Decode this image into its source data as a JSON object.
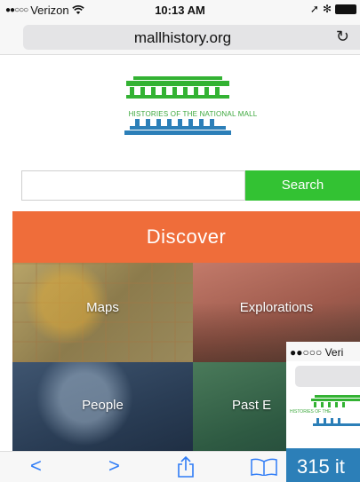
{
  "status_bar": {
    "signal": "●●○○○",
    "carrier": "Verizon",
    "wifi_icon": "wifi-icon",
    "time": "10:13 AM",
    "location_icon": "➚",
    "bluetooth_icon": "✻"
  },
  "url_bar": {
    "url": "mallhistory.org",
    "reload_glyph": "↻"
  },
  "site": {
    "logo_text": "HISTORIES OF THE NATIONAL MALL",
    "colors": {
      "green": "#33c233",
      "blue": "#2c7fb8",
      "orange": "#ef6d3a"
    }
  },
  "search": {
    "placeholder": "",
    "button_label": "Search"
  },
  "discover": {
    "heading": "Discover",
    "tiles": [
      {
        "label": "Maps"
      },
      {
        "label": "Explorations"
      },
      {
        "label": "People"
      },
      {
        "label": "Past E"
      }
    ]
  },
  "overlay": {
    "status_text": "●●○○○ Veri",
    "logo_text": "HISTORIES OF THE",
    "blue_text": "315 it"
  },
  "toolbar": {
    "back": "<",
    "forward": ">",
    "share": "⇧",
    "bookmarks": "📖"
  }
}
